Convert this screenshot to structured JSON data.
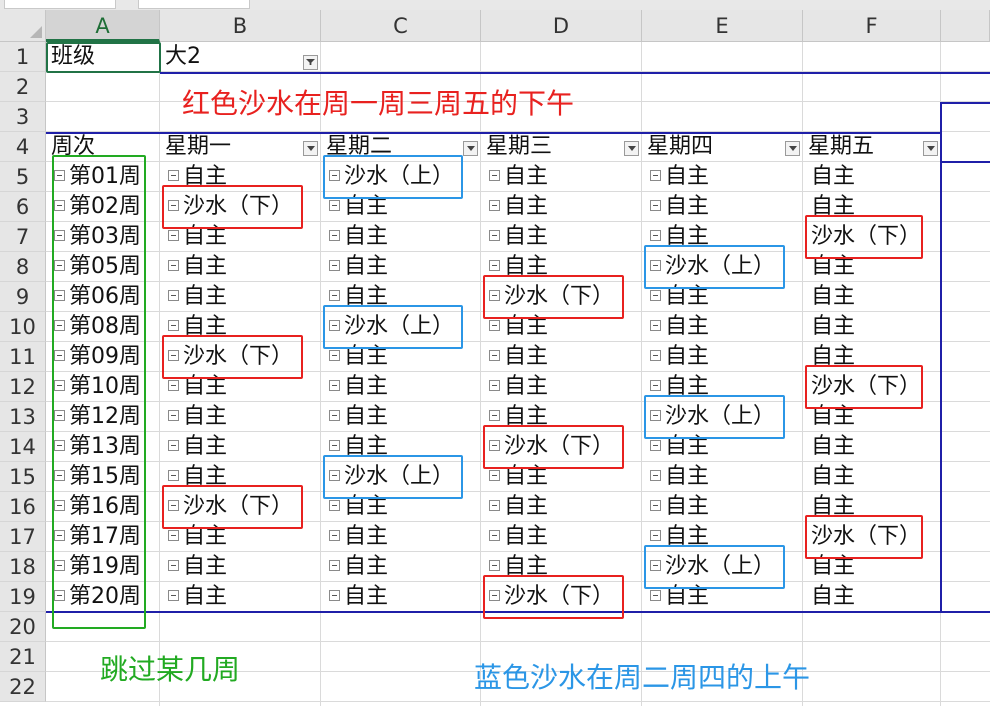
{
  "columns": [
    "A",
    "B",
    "C",
    "D",
    "E",
    "F"
  ],
  "rows": [
    "1",
    "2",
    "3",
    "4",
    "5",
    "6",
    "7",
    "8",
    "9",
    "10",
    "11",
    "12",
    "13",
    "14",
    "15",
    "16",
    "17",
    "18",
    "19",
    "20",
    "21",
    "22"
  ],
  "filter": {
    "label": "班级",
    "value": "大2"
  },
  "pivot": {
    "row_header": "周次",
    "day_headers": [
      "星期一",
      "星期二",
      "星期三",
      "星期四",
      "星期五"
    ],
    "weeks": [
      "第01周",
      "第02周",
      "第03周",
      "第05周",
      "第06周",
      "第08周",
      "第09周",
      "第10周",
      "第12周",
      "第13周",
      "第15周",
      "第16周",
      "第17周",
      "第19周",
      "第20周"
    ],
    "cells": [
      [
        "自主",
        "沙水（上）",
        "自主",
        "自主",
        "自主"
      ],
      [
        "沙水（下）",
        "自主",
        "自主",
        "自主",
        "自主"
      ],
      [
        "自主",
        "自主",
        "自主",
        "自主",
        "沙水（下）"
      ],
      [
        "自主",
        "自主",
        "自主",
        "沙水（上）",
        "自主"
      ],
      [
        "自主",
        "自主",
        "沙水（下）",
        "自主",
        "自主"
      ],
      [
        "自主",
        "沙水（上）",
        "自主",
        "自主",
        "自主"
      ],
      [
        "沙水（下）",
        "自主",
        "自主",
        "自主",
        "自主"
      ],
      [
        "自主",
        "自主",
        "自主",
        "自主",
        "沙水（下）"
      ],
      [
        "自主",
        "自主",
        "自主",
        "沙水（上）",
        "自主"
      ],
      [
        "自主",
        "自主",
        "沙水（下）",
        "自主",
        "自主"
      ],
      [
        "自主",
        "沙水（上）",
        "自主",
        "自主",
        "自主"
      ],
      [
        "沙水（下）",
        "自主",
        "自主",
        "自主",
        "自主"
      ],
      [
        "自主",
        "自主",
        "自主",
        "自主",
        "沙水（下）"
      ],
      [
        "自主",
        "自主",
        "自主",
        "沙水（上）",
        "自主"
      ],
      [
        "自主",
        "自主",
        "沙水（下）",
        "自主",
        "自主"
      ]
    ]
  },
  "annotations": {
    "red_note": "红色沙水在周一周三周五的下午",
    "green_note": "跳过某几周",
    "blue_note": "蓝色沙水在周二周四的上午"
  },
  "colors": {
    "red": "#e8211f",
    "blue": "#2b96e6",
    "green": "#22aa22",
    "navy": "#1f1fa8",
    "header_selected": "#217346"
  }
}
